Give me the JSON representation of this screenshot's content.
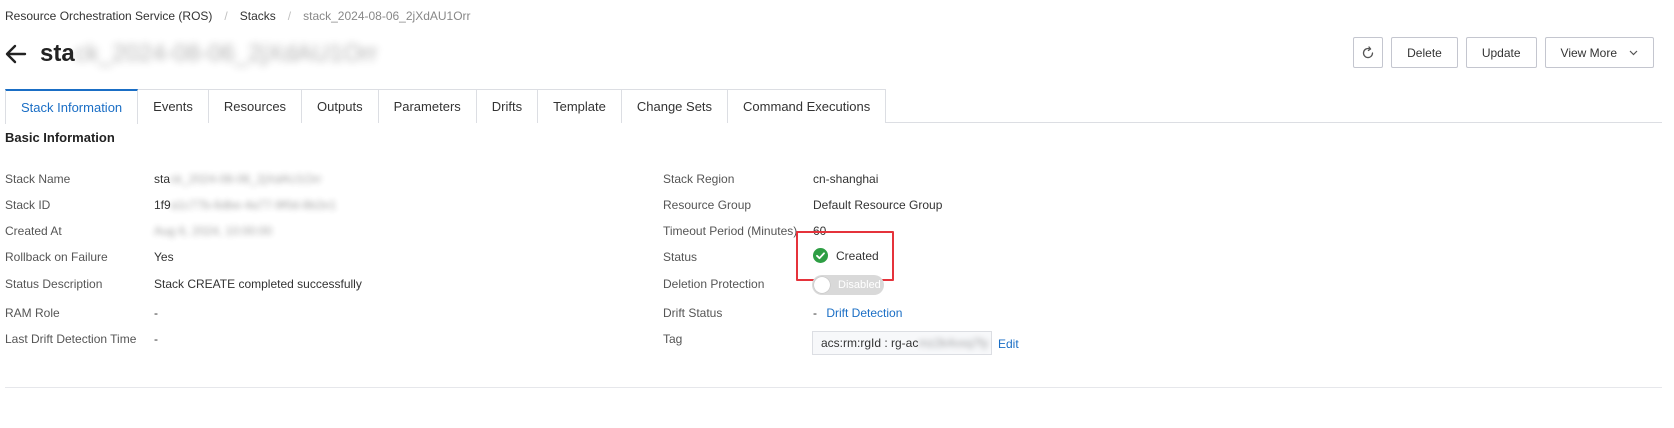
{
  "breadcrumb": {
    "items": [
      "Resource Orchestration Service (ROS)",
      "Stacks"
    ],
    "separator": "/",
    "current": "stack_2024-08-06_2jXdAU1Orr"
  },
  "header": {
    "title_prefix": "sta",
    "title_obscured": "ck_2024-08-06_2jXdAU1Orr",
    "back_icon": "arrow-left-icon"
  },
  "actions": {
    "refresh_icon": "refresh-icon",
    "delete_label": "Delete",
    "update_label": "Update",
    "view_more_label": "View More"
  },
  "tabs": [
    {
      "label": "Stack Information",
      "active": true
    },
    {
      "label": "Events"
    },
    {
      "label": "Resources"
    },
    {
      "label": "Outputs"
    },
    {
      "label": "Parameters"
    },
    {
      "label": "Drifts"
    },
    {
      "label": "Template"
    },
    {
      "label": "Change Sets"
    },
    {
      "label": "Command Executions"
    }
  ],
  "section": {
    "title": "Basic Information"
  },
  "left": {
    "stack_name": {
      "label": "Stack Name",
      "value_prefix": "sta",
      "value_obscured": "ck_2024-08-06_2jXdAU1Orr"
    },
    "stack_id": {
      "label": "Stack ID",
      "value_prefix": "1f9",
      "value_obscured": "a1c77b-6dbe-4a77-9f0d-8b2e1"
    },
    "created_at": {
      "label": "Created At",
      "value_obscured": "Aug 6, 2024, 10:00:00"
    },
    "rollback": {
      "label": "Rollback on Failure",
      "value": "Yes"
    },
    "status_desc": {
      "label": "Status Description",
      "value": "Stack CREATE completed successfully"
    },
    "ram_role": {
      "label": "RAM Role",
      "value": "-"
    },
    "last_drift": {
      "label": "Last Drift Detection Time",
      "value": "-"
    }
  },
  "right": {
    "region": {
      "label": "Stack Region",
      "value": "cn-shanghai"
    },
    "resource_group": {
      "label": "Resource Group",
      "value": "Default Resource Group"
    },
    "timeout": {
      "label": "Timeout Period (Minutes)",
      "value": "60"
    },
    "status": {
      "label": "Status",
      "value": "Created",
      "icon": "check-circle-icon",
      "color": "#2e9e44"
    },
    "deletion_protection": {
      "label": "Deletion Protection",
      "value": "Disabled"
    },
    "drift_status": {
      "label": "Drift Status",
      "value": "-",
      "link": "Drift Detection"
    },
    "tag": {
      "label": "Tag",
      "value_prefix": "acs:rm:rgId : rg-ac",
      "value_obscured": "mz2k4vxq7fy",
      "edit_label": "Edit"
    }
  },
  "colors": {
    "accent": "#1a6ec5",
    "highlight_box": "#e5333b",
    "success": "#2e9e44"
  }
}
